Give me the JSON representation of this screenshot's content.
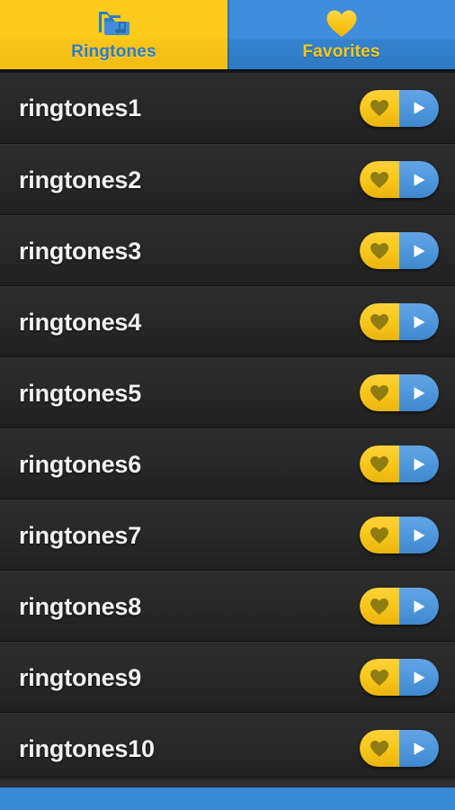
{
  "app": {
    "title": "Ringtones"
  },
  "tabs": [
    {
      "id": "ringtones",
      "label": "Ringtones",
      "icon": "folder-music-icon",
      "selected": true,
      "bg_color": "#fccb1b",
      "text_color": "#2e7cc6"
    },
    {
      "id": "favorites",
      "label": "Favorites",
      "icon": "heart-icon",
      "selected": false,
      "bg_color": "#3f8ddb",
      "text_color": "#fbc81c"
    }
  ],
  "list": {
    "rows": [
      {
        "title": "ringtones1",
        "favorite_label": "Favorite",
        "play_label": "Play"
      },
      {
        "title": "ringtones2",
        "favorite_label": "Favorite",
        "play_label": "Play"
      },
      {
        "title": "ringtones3",
        "favorite_label": "Favorite",
        "play_label": "Play"
      },
      {
        "title": "ringtones4",
        "favorite_label": "Favorite",
        "play_label": "Play"
      },
      {
        "title": "ringtones5",
        "favorite_label": "Favorite",
        "play_label": "Play"
      },
      {
        "title": "ringtones6",
        "favorite_label": "Favorite",
        "play_label": "Play"
      },
      {
        "title": "ringtones7",
        "favorite_label": "Favorite",
        "play_label": "Play"
      },
      {
        "title": "ringtones8",
        "favorite_label": "Favorite",
        "play_label": "Play"
      },
      {
        "title": "ringtones9",
        "favorite_label": "Favorite",
        "play_label": "Play"
      },
      {
        "title": "ringtones10",
        "favorite_label": "Favorite",
        "play_label": "Play"
      }
    ]
  },
  "colors": {
    "accent_yellow": "#fbc81c",
    "accent_blue": "#3889d4",
    "heart_fill": "#8f7c12",
    "play_fill": "#ffffff",
    "row_background": "#282828",
    "page_background": "#1e1e1e"
  },
  "bottom_bar": {
    "color": "#3889d4"
  }
}
